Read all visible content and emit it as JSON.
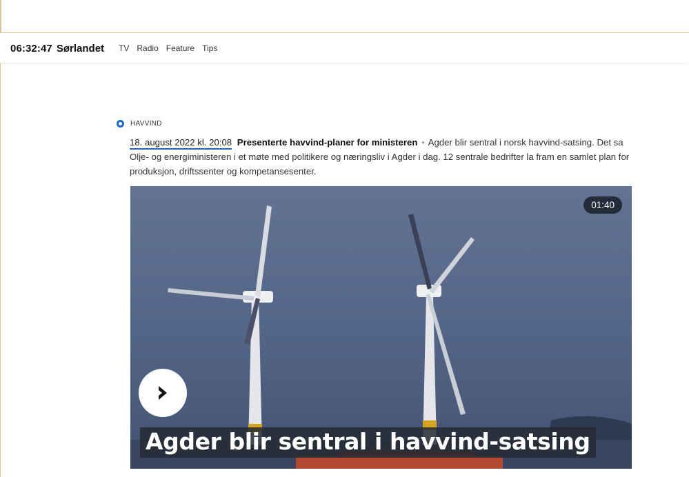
{
  "nav": {
    "clock": "06:32:47",
    "region": "Sørlandet",
    "links": [
      "TV",
      "Radio",
      "Feature",
      "Tips"
    ]
  },
  "entry": {
    "category": "HAVVIND",
    "timestamp": "18. august 2022 kl. 20:08",
    "title": "Presenterte havvind-planer for ministeren",
    "separator": "•",
    "body": "Agder blir sentral i norsk havvind-satsing. Det sa Olje- og energiministeren i et møte med politikere og næringsliv i Agder i dag. 12 sentrale bedrifter la fram en samlet plan for produksjon, driftssenter og kompetansesenter."
  },
  "video": {
    "duration": "01:40",
    "caption": "Agder blir sentral i havvind-satsing",
    "play_icon": "chevron-right-icon"
  },
  "colors": {
    "accent": "#1767ce",
    "border": "#d8c59a",
    "sky": "#536485"
  }
}
